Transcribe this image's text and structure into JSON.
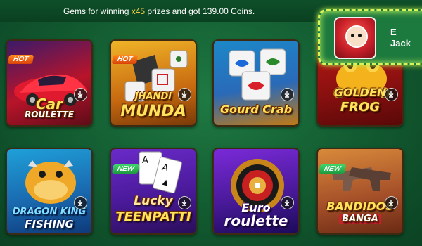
{
  "ticker": {
    "prefix": "Gems for winning ",
    "multiplier": "x45",
    "middle": " prizes and got ",
    "amount": "139.00",
    "suffix": " Coins."
  },
  "jackpot_popup": {
    "thumb_icon": "daruma-icon",
    "line1": "E",
    "line2": "Jack"
  },
  "games": [
    {
      "id": "car-roulette",
      "title_line1": "Car",
      "title_line2": "ROULETTE",
      "badge": "HOT"
    },
    {
      "id": "jhandi-munda",
      "title_line1": "JHANDI",
      "title_line2": "MUNDA",
      "badge": "HOT"
    },
    {
      "id": "gourd-crab",
      "title_line1": "Gourd Crab",
      "title_line2": "",
      "badge": ""
    },
    {
      "id": "golden-frog",
      "title_line1": "GOLDEN",
      "title_line2": "FROG",
      "badge": ""
    },
    {
      "id": "dragon-king-fishing",
      "title_line1": "DRAGON KING",
      "title_line2": "FISHING",
      "badge": ""
    },
    {
      "id": "lucky-teen-patti",
      "title_line1": "Lucky",
      "title_line2": "TEENPATTI",
      "badge": "NEW"
    },
    {
      "id": "euro-roulette",
      "title_line1": "Euro",
      "title_line2": "roulette",
      "badge": ""
    },
    {
      "id": "bandidos-banga",
      "title_line1": "BANDIDOS",
      "title_line2": "BANGA",
      "badge": "NEW"
    }
  ],
  "colors": {
    "background": "#125a30",
    "highlight": "#ffd34a",
    "title_gold": "#ffe35a",
    "hot_badge": "#ff8a1c",
    "new_badge": "#3fd56a",
    "popup_border": "#d8f25a"
  }
}
